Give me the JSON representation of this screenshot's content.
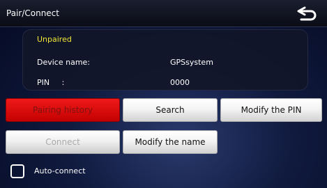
{
  "header": {
    "title": "Pair/Connect",
    "back_icon": "return-arrow-icon"
  },
  "info": {
    "status": "Unpaired",
    "device_name_label": "Device name:",
    "device_name_value": "GPSsystem",
    "pin_label": "PIN     :",
    "pin_value": "0000"
  },
  "buttons": {
    "pairing_history": "Pairing history",
    "search": "Search",
    "modify_pin": "Modify the PIN",
    "connect": "Connect",
    "modify_name": "Modify the name"
  },
  "auto_connect": {
    "label": "Auto-connect",
    "checked": false
  },
  "colors": {
    "status_yellow": "#f0e635",
    "active_red": "#e00000",
    "background": "#101a3e"
  }
}
